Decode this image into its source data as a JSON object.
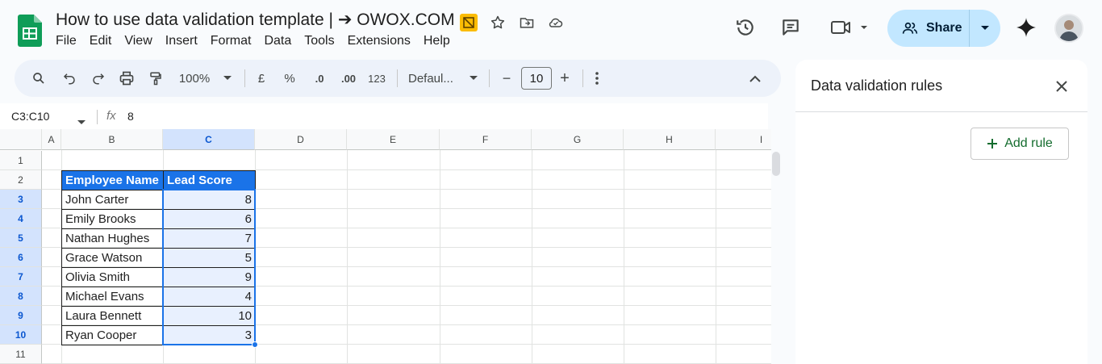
{
  "header": {
    "title": "How to use data validation template | ➔ OWOX.COM",
    "menu": [
      "File",
      "Edit",
      "View",
      "Insert",
      "Format",
      "Data",
      "Tools",
      "Extensions",
      "Help"
    ],
    "share_label": "Share"
  },
  "toolbar": {
    "zoom": "100%",
    "currency": "£",
    "percent": "%",
    "decrease_decimal": ".0",
    "increase_decimal": ".00",
    "number_format": "123",
    "font": "Defaul...",
    "font_size": "10",
    "minus": "−",
    "plus": "+"
  },
  "formula_bar": {
    "name_box": "C3:C10",
    "fx": "fx",
    "value": "8"
  },
  "grid": {
    "columns": [
      "A",
      "B",
      "C",
      "D",
      "E",
      "F",
      "G",
      "H",
      "I"
    ],
    "rows": [
      "1",
      "2",
      "3",
      "4",
      "5",
      "6",
      "7",
      "8",
      "9",
      "10",
      "11"
    ],
    "selected_column": "C",
    "table_headers": [
      "Employee Name",
      "Lead Score"
    ],
    "table_rows": [
      {
        "name": "John Carter",
        "score": "8"
      },
      {
        "name": "Emily Brooks",
        "score": "6"
      },
      {
        "name": "Nathan Hughes",
        "score": "7"
      },
      {
        "name": "Grace Watson",
        "score": "5"
      },
      {
        "name": "Olivia Smith",
        "score": "9"
      },
      {
        "name": "Michael Evans",
        "score": "4"
      },
      {
        "name": "Laura Bennett",
        "score": "10"
      },
      {
        "name": "Ryan Cooper",
        "score": "3"
      }
    ]
  },
  "panel": {
    "title": "Data validation rules",
    "add_rule_label": "Add rule"
  },
  "colors": {
    "accent": "#1a73e8",
    "share_bg": "#c2e7ff",
    "header_fill": "#1a73e8",
    "selection_fill": "#e8f0fe",
    "add_rule_text": "#146c2e"
  }
}
